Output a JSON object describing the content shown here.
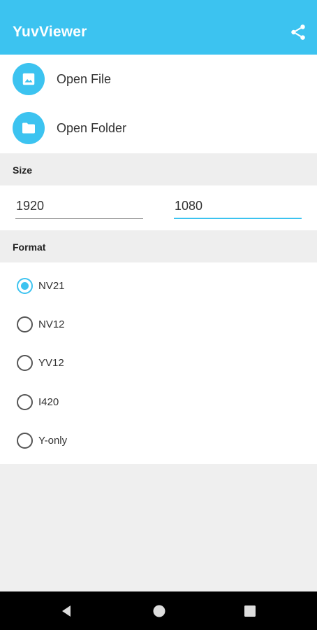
{
  "app_bar": {
    "title": "YuvViewer",
    "share_icon": "share-icon",
    "background": "#3cc3f0"
  },
  "actions": [
    {
      "label": "Open File",
      "icon": "image-icon"
    },
    {
      "label": "Open Folder",
      "icon": "folder-icon"
    }
  ],
  "size": {
    "header": "Size",
    "width": "1920",
    "height": "1080"
  },
  "format": {
    "header": "Format",
    "options": [
      "NV21",
      "NV12",
      "YV12",
      "I420",
      "Y-only"
    ],
    "selected": "NV21"
  },
  "nav_bar": {
    "back_icon": "back-triangle-icon",
    "home_icon": "home-circle-icon",
    "recents_icon": "recents-square-icon"
  }
}
